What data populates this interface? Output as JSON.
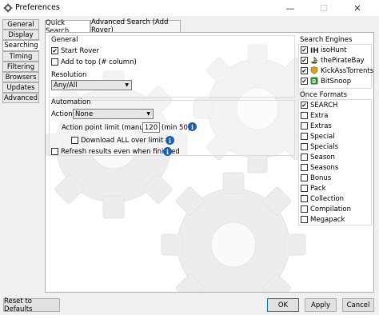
{
  "window": {
    "title": "Preferences",
    "min": "—",
    "max": "☐",
    "close": "✕"
  },
  "sidebar": {
    "tabs": [
      "General",
      "Display",
      "Searching",
      "Timing",
      "Filtering",
      "Browsers",
      "Updates",
      "Advanced"
    ],
    "active_index": 2
  },
  "top_tabs": {
    "quick": "Quick Search",
    "advanced": "Advanced Search (Add Rover)"
  },
  "general": {
    "title": "General",
    "start_rover": "Start Rover",
    "add_to_top": "Add to top (# column)",
    "resolution_label": "Resolution",
    "resolution_value": "Any/All"
  },
  "automation": {
    "title": "Automation",
    "action_label": "Action",
    "action_value": "None",
    "limit_label": "Action point limit (manual)",
    "limit_value": "120",
    "limit_hint": "(min 50)",
    "download_all": "Download ALL over limit",
    "refresh": "Refresh results even when finished"
  },
  "search_engines": {
    "title": "Search Engines",
    "items": [
      "isoHunt",
      "thePirateBay",
      "KickAssTorrents",
      "BitSnoop"
    ]
  },
  "once_formats": {
    "title": "Once Formats",
    "items": [
      "SEARCH",
      "Extra",
      "Extras",
      "Special",
      "Specials",
      "Season",
      "Seasons",
      "Bonus",
      "Pack",
      "Collection",
      "Compilation",
      "Megapack"
    ]
  },
  "buttons": {
    "reset": "Reset to Defaults",
    "ok": "OK",
    "apply": "Apply",
    "cancel": "Cancel"
  },
  "icons": {
    "info": "i",
    "arrow": "▼"
  },
  "colors": {
    "info_blue": "#1a5fb4",
    "ok_border": "#0078d7"
  }
}
